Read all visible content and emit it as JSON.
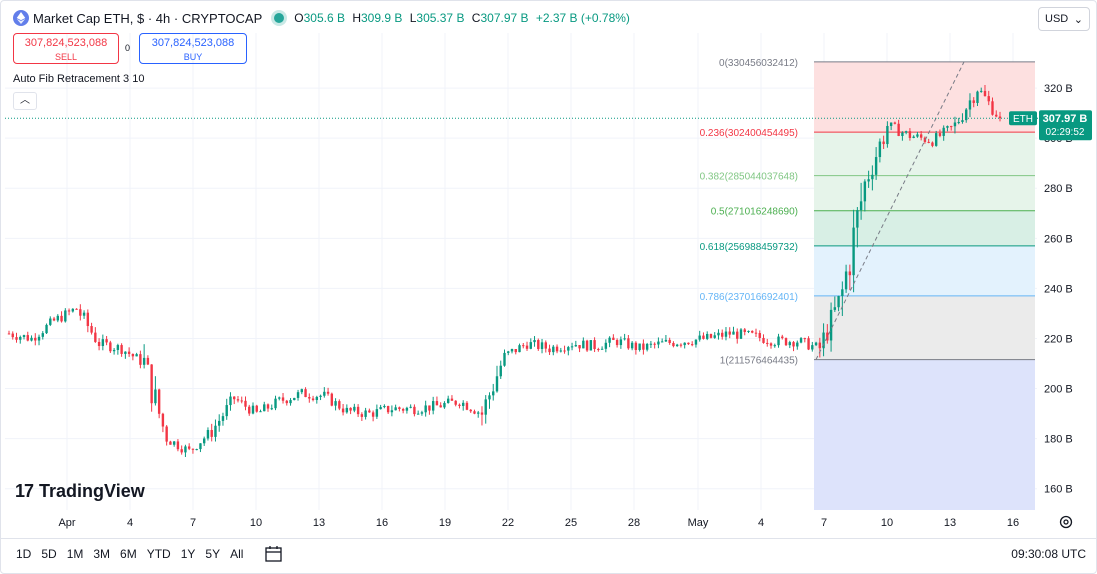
{
  "header": {
    "title": "Market Cap ETH, $ · 4h · CRYPTOCAP",
    "ohlc": [
      {
        "k": "O",
        "v": "305.6 B"
      },
      {
        "k": "H",
        "v": "309.9 B"
      },
      {
        "k": "L",
        "v": "305.37 B"
      },
      {
        "k": "C",
        "v": "307.97 B"
      },
      {
        "k": "",
        "v": "+2.37 B (+0.78%)"
      }
    ],
    "currency": "USD"
  },
  "trade": {
    "sell_value": "307,824,523,088",
    "sell_label": "SELL",
    "spread": "0",
    "buy_value": "307,824,523,088",
    "buy_label": "BUY"
  },
  "study": {
    "label": "Auto Fib Retracement 3 10"
  },
  "price_tag": {
    "symbol": "ETH",
    "value": "307.97 B",
    "countdown": "02:29:52"
  },
  "fib_levels": [
    {
      "label": "0(330456032412)",
      "value": 330.456,
      "color": "#787b86",
      "fill": "#fde0e0"
    },
    {
      "label": "0.236(302400454495)",
      "value": 302.4,
      "color": "#f23645",
      "fill": "#e6f4ea"
    },
    {
      "label": "0.382(285044037648)",
      "value": 285.044,
      "color": "#81c784",
      "fill": "#e6f4ea"
    },
    {
      "label": "0.5(271016248690)",
      "value": 271.016,
      "color": "#4caf50",
      "fill": "#d8efe5"
    },
    {
      "label": "0.618(256988459732)",
      "value": 256.988,
      "color": "#089981",
      "fill": "#e3f2fd"
    },
    {
      "label": "0.786(237016692401)",
      "value": 237.017,
      "color": "#64b5f6",
      "fill": "#ebebeb"
    },
    {
      "label": "1(211576464435)",
      "value": 211.576,
      "color": "#787b86",
      "fill": "#dde3fb"
    }
  ],
  "y_axis": {
    "ticks": [
      "320 B",
      "300 B",
      "280 B",
      "260 B",
      "240 B",
      "220 B",
      "200 B",
      "180 B",
      "160 B"
    ],
    "tick_values": [
      320,
      300,
      280,
      260,
      240,
      220,
      200,
      180,
      160
    ]
  },
  "x_axis": {
    "ticks": [
      "Apr",
      "4",
      "7",
      "10",
      "13",
      "16",
      "19",
      "22",
      "25",
      "28",
      "May",
      "4",
      "7",
      "10",
      "13",
      "16"
    ]
  },
  "chart_data": {
    "type": "candlestick",
    "timeframe": "4h",
    "unit": "B USD",
    "ylim": [
      151.5,
      342
    ],
    "current_close": 307.97,
    "approx_path": [
      {
        "x": "Apr 1",
        "close": 222
      },
      {
        "x": "Apr 2",
        "close": 220
      },
      {
        "x": "Apr 3",
        "close": 227
      },
      {
        "x": "Apr 4",
        "close": 232
      },
      {
        "x": "Apr 5",
        "close": 218
      },
      {
        "x": "Apr 6",
        "close": 216
      },
      {
        "x": "Apr 7",
        "close": 210
      },
      {
        "x": "Apr 8",
        "close": 180
      },
      {
        "x": "Apr 9",
        "close": 175
      },
      {
        "x": "Apr 10",
        "close": 183
      },
      {
        "x": "Apr 11",
        "close": 196
      },
      {
        "x": "Apr 12",
        "close": 190
      },
      {
        "x": "Apr 13",
        "close": 195
      },
      {
        "x": "Apr 14",
        "close": 198
      },
      {
        "x": "Apr 15",
        "close": 197
      },
      {
        "x": "Apr 16",
        "close": 191
      },
      {
        "x": "Apr 17",
        "close": 190
      },
      {
        "x": "Apr 18",
        "close": 192
      },
      {
        "x": "Apr 19",
        "close": 192
      },
      {
        "x": "Apr 20",
        "close": 193
      },
      {
        "x": "Apr 21",
        "close": 195
      },
      {
        "x": "Apr 22",
        "close": 190
      },
      {
        "x": "Apr 23",
        "close": 213
      },
      {
        "x": "Apr 24",
        "close": 218
      },
      {
        "x": "Apr 25",
        "close": 216
      },
      {
        "x": "Apr 26",
        "close": 218
      },
      {
        "x": "Apr 27",
        "close": 217
      },
      {
        "x": "Apr 28",
        "close": 219
      },
      {
        "x": "Apr 29",
        "close": 216
      },
      {
        "x": "Apr 30",
        "close": 218
      },
      {
        "x": "May 1",
        "close": 219
      },
      {
        "x": "May 2",
        "close": 220
      },
      {
        "x": "May 3",
        "close": 222
      },
      {
        "x": "May 4",
        "close": 221
      },
      {
        "x": "May 5",
        "close": 219
      },
      {
        "x": "May 6",
        "close": 219
      },
      {
        "x": "May 7",
        "close": 216
      },
      {
        "x": "May 8",
        "close": 238
      },
      {
        "x": "May 9",
        "close": 282
      },
      {
        "x": "May 10",
        "close": 305
      },
      {
        "x": "May 11",
        "close": 301
      },
      {
        "x": "May 12",
        "close": 299
      },
      {
        "x": "May 13",
        "close": 305
      },
      {
        "x": "May 14",
        "close": 320
      },
      {
        "x": "May 15",
        "close": 308
      }
    ]
  },
  "bottom": {
    "ranges": [
      "1D",
      "5D",
      "1M",
      "3M",
      "6M",
      "YTD",
      "1Y",
      "5Y",
      "All"
    ],
    "clock": "09:30:08 UTC"
  },
  "brand": "TradingView"
}
